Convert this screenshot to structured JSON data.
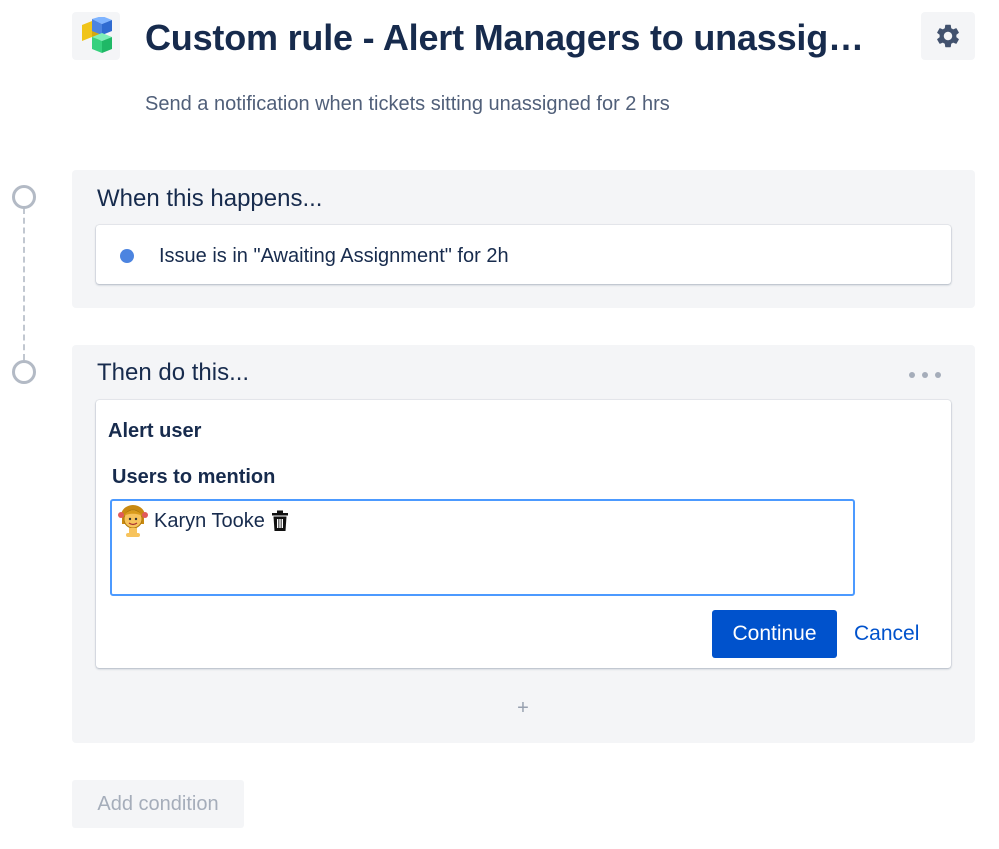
{
  "header": {
    "title": "Custom rule - Alert Managers to unassigned tickets",
    "description": "Send a notification when tickets sitting unassigned for 2 hrs",
    "logo_icon": "stacked-cubes-icon",
    "settings_icon": "gear-icon"
  },
  "trigger_panel": {
    "heading": "When this happens...",
    "trigger_text": "Issue is in \"Awaiting Assignment\" for 2h"
  },
  "action_panel": {
    "heading": "Then do this...",
    "menu_icon": "more-horizontal-icon",
    "action": {
      "title": "Alert user",
      "field_label": "Users to mention",
      "mentioned_users": [
        {
          "name": "Karyn Tooke",
          "avatar_icon": "avatar-icon",
          "remove_icon": "trash-icon"
        }
      ],
      "continue_label": "Continue",
      "cancel_label": "Cancel"
    },
    "add_label": "+"
  },
  "footer": {
    "add_condition_label": "Add condition"
  },
  "colors": {
    "primary": "#0052cc",
    "text": "#172b4d",
    "panel_bg": "#f4f5f7",
    "focus_border": "#4c9aff",
    "trigger_dot": "#4c84e0"
  }
}
